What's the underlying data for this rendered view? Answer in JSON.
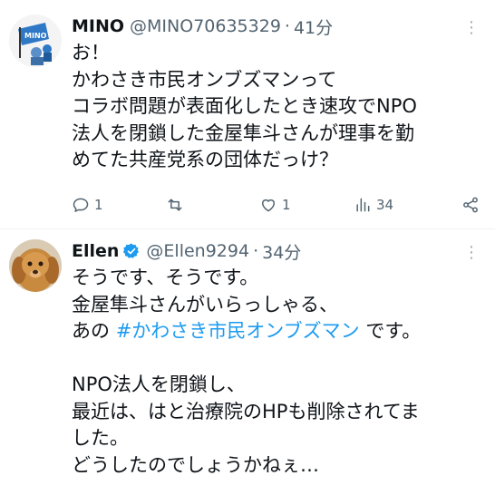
{
  "tweet1": {
    "name": "MINO",
    "handle": "@MINO70635329",
    "separator": "·",
    "time": "41分",
    "avatar_text": "MINO",
    "more": "⋮",
    "lines": [
      "お！",
      "かわさき市民オンブズマンって",
      "コラボ問題が表面化したとき速攻でNPO",
      "法人を閉鎖した金屋隼斗さんが理事を勤",
      "めてた共産党系の団体だっけ？"
    ],
    "actions": {
      "reply_count": "1",
      "like_count": "1",
      "views_count": "34"
    }
  },
  "tweet2": {
    "name": "Ellen",
    "handle": "@Ellen9294",
    "separator": "·",
    "time": "34分",
    "more": "⋮",
    "line1": "そうです、そうです。",
    "line2": "金屋隼斗さんがいらっしゃる、",
    "line3_prefix": "あの ",
    "hashtag": "#かわさき市民オンブズマン",
    "line3_suffix": " です。",
    "line4": "NPO法人を閉鎖し、",
    "line5": "最近は、はと治療院のHPも削除されてま",
    "line6": "した。",
    "line7": "どうしたのでしょうかねぇ…"
  },
  "colors": {
    "text": "#0f1419",
    "secondary": "#536471",
    "link": "#1d9bf0",
    "verified": "#1d9bf0",
    "divider": "#eff3f4"
  },
  "icons": {
    "reply": "reply-icon",
    "retweet": "retweet-icon",
    "like": "like-icon",
    "views": "views-icon",
    "share": "share-icon",
    "verified": "verified-badge-icon"
  }
}
